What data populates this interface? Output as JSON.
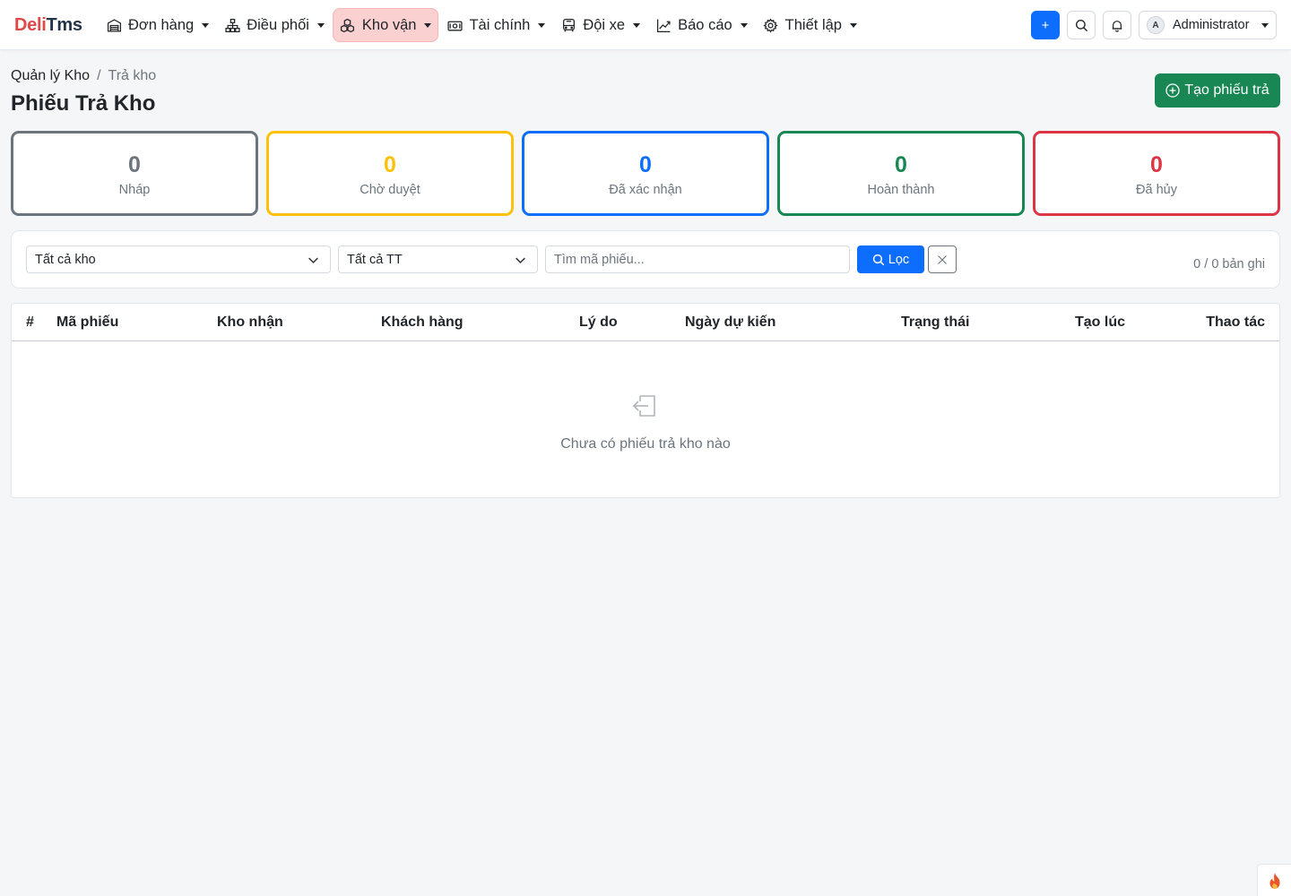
{
  "brand": {
    "part1": "Deli",
    "part2": "Tms"
  },
  "nav": [
    {
      "label": "Đơn hàng",
      "icon": "warehouse-icon",
      "active": false
    },
    {
      "label": "Điều phối",
      "icon": "diagram-icon",
      "active": false
    },
    {
      "label": "Kho vận",
      "icon": "boxes-icon",
      "active": true
    },
    {
      "label": "Tài chính",
      "icon": "cash-icon",
      "active": false
    },
    {
      "label": "Đội xe",
      "icon": "bus-icon",
      "active": false
    },
    {
      "label": "Báo cáo",
      "icon": "chart-line-icon",
      "active": false
    },
    {
      "label": "Thiết lập",
      "icon": "gear-icon",
      "active": false
    }
  ],
  "topbar": {
    "plus_label": "+",
    "user": {
      "avatar": "A",
      "name": "Administrator"
    }
  },
  "breadcrumb": {
    "home": "Quản lý Kho",
    "separator": "/",
    "current": "Trả kho"
  },
  "page_title": "Phiếu Trả Kho",
  "create_button": "Tạo phiếu trả",
  "stats": [
    {
      "value": "0",
      "label": "Nháp",
      "color": "#6c757d"
    },
    {
      "value": "0",
      "label": "Chờ duyệt",
      "color": "#ffc107"
    },
    {
      "value": "0",
      "label": "Đã xác nhận",
      "color": "#0d6efd"
    },
    {
      "value": "0",
      "label": "Hoàn thành",
      "color": "#198754"
    },
    {
      "value": "0",
      "label": "Đã hủy",
      "color": "#dc3545"
    }
  ],
  "filters": {
    "warehouse_selected": "Tất cả kho",
    "status_selected": "Tất cả TT",
    "search_placeholder": "Tìm mã phiếu...",
    "filter_button": "Lọc",
    "record_count": "0 / 0 bản ghi"
  },
  "table": {
    "columns": [
      "#",
      "Mã phiếu",
      "Kho nhận",
      "Khách hàng",
      "Lý do",
      "Ngày dự kiến",
      "Trạng thái",
      "Tạo lúc",
      "Thao tác"
    ],
    "rows": [],
    "empty_text": "Chưa có phiếu trả kho nào"
  },
  "colors": {
    "brand_red": "#e04848",
    "primary": "#0d6efd",
    "success": "#198754",
    "active_nav_bg": "#fbd0d0"
  }
}
